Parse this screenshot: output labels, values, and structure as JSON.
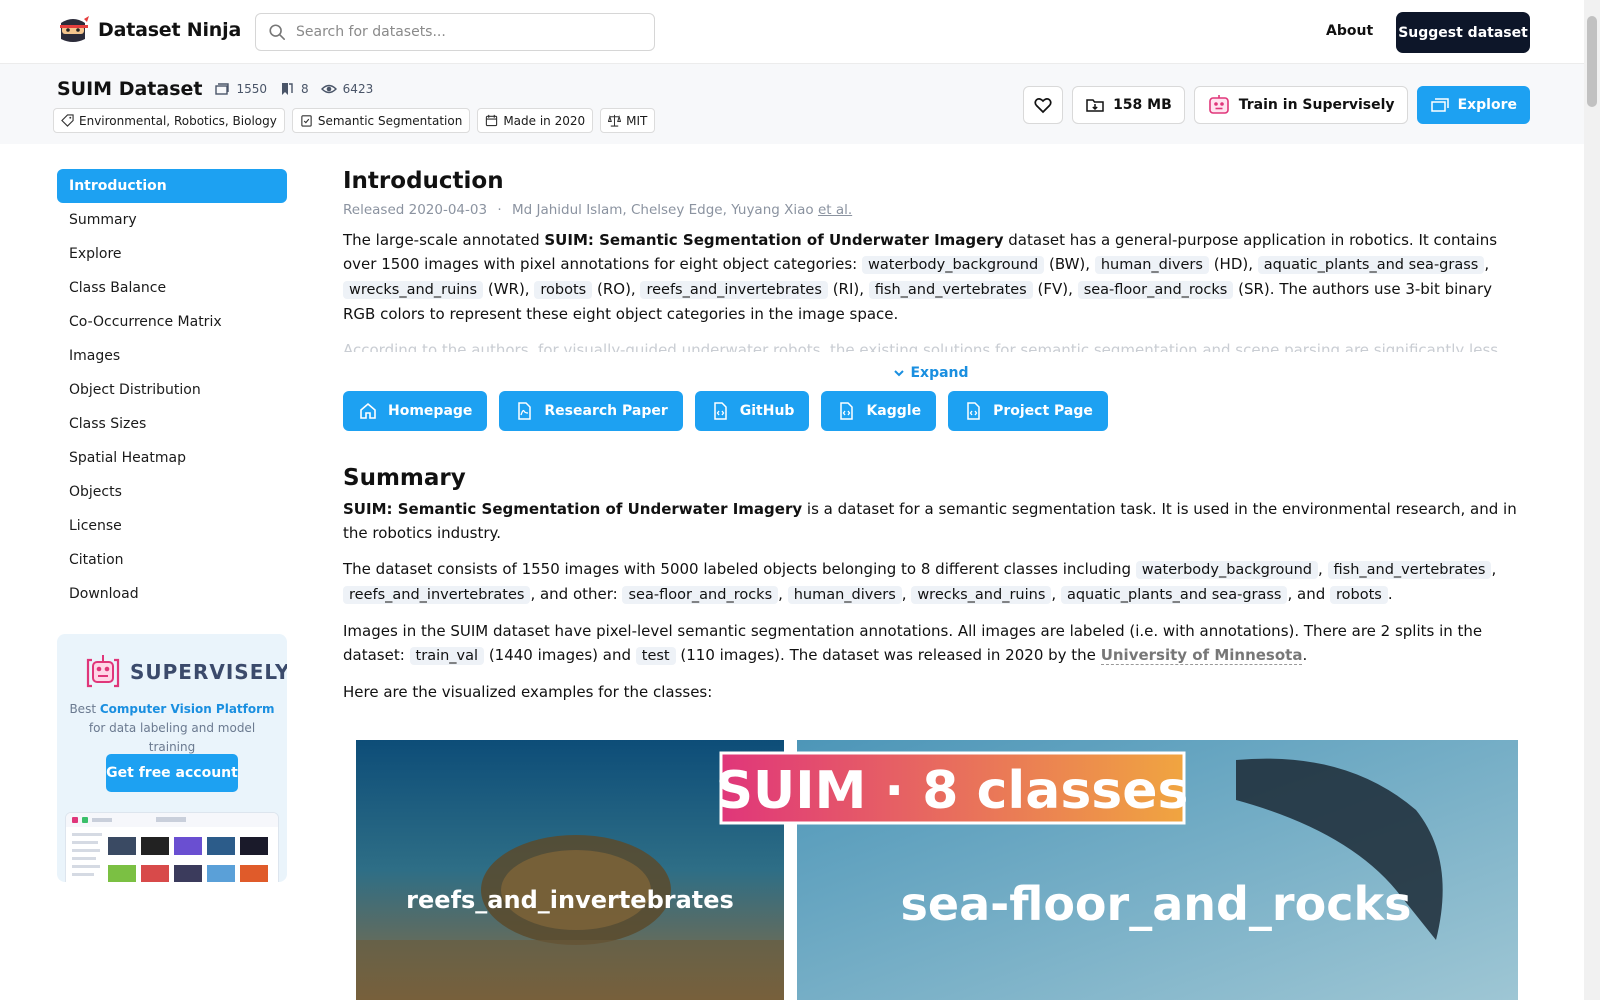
{
  "nav": {
    "brand": "Dataset Ninja",
    "search_placeholder": "Search for datasets...",
    "about": "About",
    "suggest": "Suggest dataset"
  },
  "dataset": {
    "title": "SUIM Dataset",
    "stats": {
      "images": "1550",
      "classes": "8",
      "views": "6423"
    },
    "tags": [
      "Environmental, Robotics, Biology",
      "Semantic Segmentation",
      "Made in 2020",
      "MIT"
    ],
    "buttons": {
      "size": "158 MB",
      "train": "Train in Supervisely",
      "explore": "Explore"
    }
  },
  "sidebar": {
    "items": [
      "Introduction",
      "Summary",
      "Explore",
      "Class Balance",
      "Co-Occurrence Matrix",
      "Images",
      "Object Distribution",
      "Class Sizes",
      "Spatial Heatmap",
      "Objects",
      "License",
      "Citation",
      "Download"
    ]
  },
  "promo": {
    "name": "SUPERVISELY",
    "text_pre": "Best ",
    "text_highlight": "Computer Vision Platform",
    "text_post": " for data labeling and model training",
    "button": "Get free account"
  },
  "intro": {
    "title": "Introduction",
    "released": "Released 2020-04-03",
    "sep": "·",
    "authors": "Md Jahidul Islam, Chelsey Edge, Yuyang Xiao",
    "etal": "et al.",
    "p_pre": "The large-scale annotated ",
    "p_bold": "SUIM: Semantic Segmentation of Underwater Imagery",
    "p_mid": " dataset has a general-purpose application in robotics. It contains over 1500 images with pixel annotations for eight object categories: ",
    "classes": [
      {
        "name": "waterbody_background",
        "abbr": "(BW),"
      },
      {
        "name": "human_divers",
        "abbr": "(HD),"
      },
      {
        "name": "aquatic_plants_and sea-grass",
        "abbr": ","
      },
      {
        "name": "wrecks_and_ruins",
        "abbr": "(WR),"
      },
      {
        "name": "robots",
        "abbr": "(RO),"
      },
      {
        "name": "reefs_and_invertebrates",
        "abbr": "(RI),"
      },
      {
        "name": "fish_and_vertebrates",
        "abbr": "(FV),"
      },
      {
        "name": "sea-floor_and_rocks",
        "abbr": "(SR)."
      }
    ],
    "p_end": " The authors use 3-bit binary RGB colors to represent these eight object categories in the image space.",
    "faded": "According to the authors, for visually-guided underwater robots, the existing solutions for semantic segmentation and scene parsing are significantly less",
    "expand": "Expand",
    "links": [
      "Homepage",
      "Research Paper",
      "GitHub",
      "Kaggle",
      "Project Page"
    ]
  },
  "summary": {
    "title": "Summary",
    "p1_bold": "SUIM: Semantic Segmentation of Underwater Imagery",
    "p1_rest": " is a dataset for a semantic segmentation task. It is used in the environmental research, and in the robotics industry.",
    "p2_pre": "The dataset consists of 1550 images with 5000 labeled objects belonging to 8 different classes including ",
    "p2_classes_a": [
      "waterbody_background",
      "fish_and_vertebrates",
      "reefs_and_invertebrates"
    ],
    "p2_other": ", and other: ",
    "p2_classes_b": [
      "sea-floor_and_rocks",
      "human_divers",
      "wrecks_and_ruins",
      "aquatic_plants_and sea-grass"
    ],
    "p2_and": ", and ",
    "p2_last": "robots",
    "p3_pre": "Images in the SUIM dataset have pixel-level semantic segmentation annotations. All images are labeled (i.e. with annotations). There are 2 splits in the dataset: ",
    "split1": "train_val",
    "split1_count": " (1440 images) and ",
    "split2": "test",
    "p3_mid": " (110 images). The dataset was released in 2020 by the ",
    "org": "University of Minnesota",
    "p4": "Here are the visualized examples for the classes:"
  },
  "viz": {
    "banner": "SUIM · 8 classes",
    "left_label": "reefs_and_invertebrates",
    "right_label": "sea-floor_and_rocks"
  }
}
